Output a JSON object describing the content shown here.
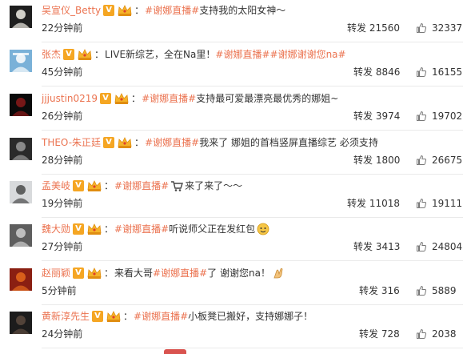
{
  "labels": {
    "repost_prefix": "转发",
    "verified_mark": "V",
    "colon": "："
  },
  "colors": {
    "username": "#eb7350",
    "hashtag": "#eb7350",
    "text": "#333333",
    "verified_badge": "#f5a623",
    "separator": "#eaeaea"
  },
  "comments": [
    {
      "username": "吴宣仪_Betty",
      "hashtag": "#谢娜直播#",
      "text_after": "支持我的太阳女神～",
      "time": "22分钟前",
      "repost_count": "21560",
      "like_count": "32337",
      "avatar_colors": [
        "#1e1e1e",
        "#f1eee6"
      ]
    },
    {
      "username": "张杰",
      "text_before": "LIVE新综艺，全在Na里！",
      "hashtag": "#谢娜直播#",
      "hashtag2": "#谢娜谢谢您na#",
      "time": "45分钟前",
      "repost_count": "8846",
      "like_count": "16155",
      "avatar_colors": [
        "#7ab1d8",
        "#ffffff"
      ]
    },
    {
      "username": "jjjustin0219",
      "hashtag": "#谢娜直播#",
      "text_after": "支持最可爱最漂亮最优秀的娜姐~",
      "time": "26分钟前",
      "repost_count": "3974",
      "like_count": "19702",
      "avatar_colors": [
        "#0a0a0a",
        "#8b1a1a"
      ]
    },
    {
      "username": "THEO-朱正廷",
      "hashtag": "#谢娜直播#",
      "text_after": "我来了 娜姐的首档竖屏直播综艺 必须支持",
      "time": "28分钟前",
      "repost_count": "1800",
      "like_count": "26675",
      "avatar_colors": [
        "#2a2a2a",
        "#9a9a9a"
      ]
    },
    {
      "username": "孟美岐",
      "hashtag": "#谢娜直播#",
      "text_after": "来了来了～～",
      "emoji": "cart-emoji",
      "time": "19分钟前",
      "repost_count": "11018",
      "like_count": "19111",
      "avatar_colors": [
        "#d8dadc",
        "#4a4a4a"
      ]
    },
    {
      "username": "魏大勋",
      "hashtag": "#谢娜直播#",
      "text_after": "听说师父正在发红包",
      "emoji": "red-packet-emoji",
      "time": "27分钟前",
      "repost_count": "3413",
      "like_count": "24804",
      "avatar_colors": [
        "#5e5e5e",
        "#cfcfcf"
      ]
    },
    {
      "username": "赵丽颖",
      "text_before": "来看大哥",
      "hashtag": "#谢娜直播#",
      "text_after": "了 谢谢您na！",
      "emoji": "clapping-hands-emoji",
      "time": "5分钟前",
      "repost_count": "316",
      "like_count": "5889",
      "avatar_colors": [
        "#8a1f12",
        "#e56a1c"
      ]
    },
    {
      "username": "黄新淳先生",
      "hashtag": "#谢娜直播#",
      "text_after": "小板凳已搬好，支持娜娜子！",
      "time": "24分钟前",
      "repost_count": "728",
      "like_count": "2038",
      "avatar_colors": [
        "#1c1c1c",
        "#5c4a3e"
      ]
    }
  ]
}
